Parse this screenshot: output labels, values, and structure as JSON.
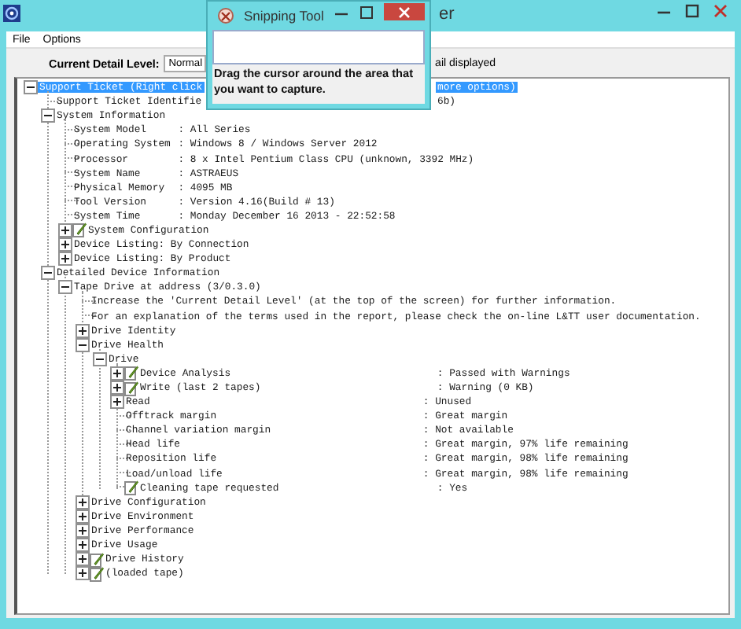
{
  "window": {
    "title": "er"
  },
  "menu": [
    "File",
    "Options"
  ],
  "detail": {
    "label": "Current Detail Level:",
    "value": "Normal",
    "note": "ail displayed"
  },
  "tree": [
    {
      "text": "Support Ticket (Right click",
      "tail": "more options)",
      "expanded": true,
      "selected": true,
      "children": [
        {
          "text": "Support Ticket Identifie",
          "tail": "6b)",
          "selected": false
        },
        {
          "text": "System Information",
          "expanded": true,
          "selected": false,
          "children": [
            {
              "text": "System Model",
              "value": ": All Series",
              "selected": false
            },
            {
              "text": "Operating System",
              "value": ": Windows 8 / Windows Server 2012",
              "selected": false
            },
            {
              "text": "Processor",
              "value": ": 8 x Intel Pentium Class CPU (unknown, 3392 MHz)",
              "selected": false
            },
            {
              "text": "System Name",
              "value": ": ASTRAEUS",
              "selected": false
            },
            {
              "text": "Physical Memory",
              "value": ": 4095 MB",
              "selected": false
            },
            {
              "text": "Tool Version",
              "value": ": Version 4.16(Build # 13)",
              "selected": false
            },
            {
              "text": "System Time",
              "value": ": Monday December 16 2013 - 22:52:58",
              "selected": false
            },
            {
              "text": "System Configuration",
              "kind": "note",
              "expanded": false,
              "selected": false
            },
            {
              "text": "Device Listing: By Connection",
              "expanded": false,
              "selected": false
            },
            {
              "text": "Device Listing: By Product",
              "expanded": false,
              "selected": false
            }
          ]
        },
        {
          "text": "Detailed Device Information",
          "expanded": true,
          "selected": false,
          "children": [
            {
              "text": "Tape Drive at address (3/0.3.0)",
              "expanded": true,
              "selected": false,
              "children": [
                {
                  "text": "Increase the 'Current Detail Level' (at the top of the screen) for further information.",
                  "selected": false
                },
                {
                  "text": "For an explanation of the terms used in the report, please check the on-line L&TT user documentation.",
                  "selected": false
                },
                {
                  "text": "Drive Identity",
                  "expanded": false,
                  "selected": false
                },
                {
                  "text": "Drive Health",
                  "expanded": true,
                  "selected": false,
                  "children": [
                    {
                      "text": "Drive",
                      "expanded": true,
                      "selected": false,
                      "children": [
                        {
                          "text": "Device Analysis",
                          "kind": "note",
                          "value": ": Passed with Warnings",
                          "expanded": false,
                          "selected": false
                        },
                        {
                          "text": "Write (last 2 tapes)",
                          "kind": "note",
                          "value": ": Warning (0 KB)",
                          "expanded": false,
                          "selected": false
                        },
                        {
                          "text": "Read",
                          "value": ": Unused",
                          "expanded": false,
                          "selected": false
                        },
                        {
                          "text": "Offtrack margin",
                          "value": ": Great margin",
                          "selected": false
                        },
                        {
                          "text": "Channel variation margin",
                          "value": ": Not available",
                          "selected": false
                        },
                        {
                          "text": "Head life",
                          "value": ": Great margin, 97% life remaining",
                          "selected": false
                        },
                        {
                          "text": "Reposition life",
                          "value": ": Great margin, 98% life remaining",
                          "selected": false
                        },
                        {
                          "text": "Load/unload life",
                          "value": ": Great margin, 98% life remaining",
                          "selected": false
                        },
                        {
                          "text": "Cleaning tape requested",
                          "kind": "note",
                          "value": ": Yes",
                          "selected": false
                        }
                      ]
                    }
                  ]
                },
                {
                  "text": "Drive Configuration",
                  "expanded": false,
                  "selected": false
                },
                {
                  "text": "Drive Environment",
                  "expanded": false,
                  "selected": false
                },
                {
                  "text": "Drive Performance",
                  "expanded": false,
                  "selected": false
                },
                {
                  "text": "Drive Usage",
                  "expanded": false,
                  "selected": false
                },
                {
                  "text": "Drive History",
                  "kind": "note",
                  "expanded": false,
                  "selected": false
                },
                {
                  "text": "(loaded tape)",
                  "kind": "note",
                  "expanded": false,
                  "selected": false
                }
              ]
            }
          ]
        }
      ]
    }
  ],
  "snipping_tool": {
    "title": "Snipping Tool",
    "message": "Drag the cursor around the area that you want to capture."
  }
}
